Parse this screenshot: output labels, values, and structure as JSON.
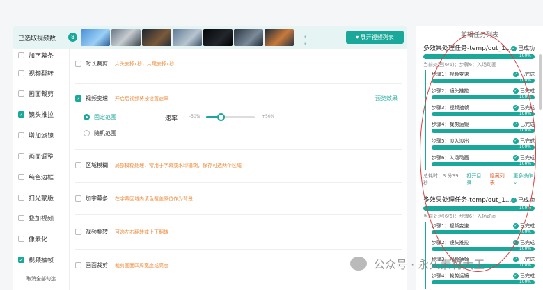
{
  "top_bar": {
    "selected_label": "已选取视频数",
    "selected_count": "8",
    "expand_button": "展开视频列表"
  },
  "left_panel": {
    "items": [
      {
        "label": "加字幕条",
        "checked": false
      },
      {
        "label": "视频翻转",
        "checked": false
      },
      {
        "label": "画面裁剪",
        "checked": false
      },
      {
        "label": "镜头推拉",
        "checked": true
      },
      {
        "label": "增加滤镜",
        "checked": false
      },
      {
        "label": "画面调整",
        "checked": false
      },
      {
        "label": "纯色边框",
        "checked": false
      },
      {
        "label": "扫光蒙版",
        "checked": false
      },
      {
        "label": "叠加视频",
        "checked": false
      },
      {
        "label": "像素化",
        "checked": false
      },
      {
        "label": "视频抽帧",
        "checked": true
      }
    ],
    "footer": "取消全部勾选"
  },
  "main_panel": {
    "trim": {
      "title": "时长裁剪",
      "hint": "片头去掉x秒，片尾去掉x秒"
    },
    "speed": {
      "title": "视频变速",
      "hint": "开启后视频将按设置速率",
      "preview": "预览效果",
      "fixed": "固定范围",
      "random": "随机范围",
      "rate_label": "速率",
      "min": "-50%",
      "max": "+50%",
      "level": 0.3
    },
    "blur": {
      "title": "区域模糊",
      "hint": "局部模糊处理，常用于字幕或水印模糊，保存可选两个区域"
    },
    "subtitle": {
      "title": "加字幕条",
      "hint": "在字幕区域内填色覆盖原位作为背景"
    },
    "flip": {
      "title": "视频翻转",
      "hint": "可选左右翻转或上下翻转"
    },
    "crop": {
      "title": "画面裁剪",
      "hint": "裁剪画面四周宽度或高度"
    }
  },
  "right_panel": {
    "title": "剪辑任务列表",
    "tasks": [
      {
        "name": "多效果处理任务-temp/out_1...",
        "status": "已成功",
        "progress": "100%",
        "sub": "当前处理(6/6)：步骤6：入场动画",
        "steps": [
          {
            "label": "步骤1：视频变速",
            "status": "已完成",
            "progress": "100%"
          },
          {
            "label": "步骤2：镜头推拉",
            "status": "已完成",
            "progress": "100%"
          },
          {
            "label": "步骤3：视频抽帧",
            "status": "已完成",
            "progress": "100%"
          },
          {
            "label": "步骤4：裁剪运镜",
            "status": "已完成",
            "progress": "100%"
          },
          {
            "label": "步骤5：淡入淡出",
            "status": "已完成",
            "progress": "100%"
          },
          {
            "label": "步骤6：入场动画",
            "status": "已完成",
            "progress": "100%"
          }
        ],
        "time": "总耗时：3 分39 秒",
        "open_dir": "打开目录",
        "hide": "隐藏列表",
        "more": "更多操作"
      },
      {
        "name": "多效果处理任务-temp/out_1...",
        "status": "已成功",
        "progress": "100%",
        "sub": "当前处理(6/6)：步骤6：入场动画",
        "steps": [
          {
            "label": "步骤1：视频变速",
            "status": "已完成",
            "progress": "100%"
          },
          {
            "label": "步骤2：镜头推拉",
            "status": "已完成",
            "progress": "100%"
          },
          {
            "label": "步骤3：视频抽帧",
            "status": "已完成",
            "progress": "100%"
          },
          {
            "label": "步骤4：裁剪运镜",
            "status": "已完成",
            "progress": "100%"
          }
        ]
      }
    ]
  },
  "watermark": {
    "text": "公众号 · 永久素材大王"
  },
  "colors": {
    "accent": "#1aa89a",
    "hint": "#f08c3c",
    "annotation": "#e03a3a"
  }
}
